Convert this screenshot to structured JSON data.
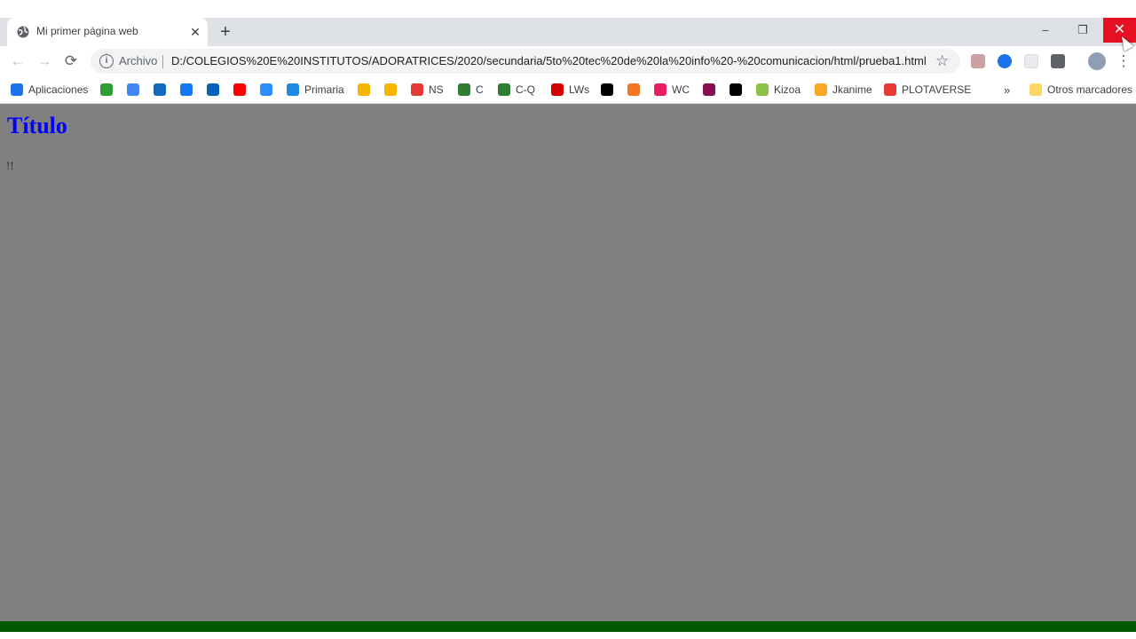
{
  "browser": {
    "tab": {
      "title": "Mi primer página web",
      "close_glyph": "✕"
    },
    "new_tab_glyph": "+",
    "window_controls": {
      "minimize": "–",
      "restore": "❐",
      "close": "✕"
    },
    "toolbar": {
      "back_glyph": "←",
      "forward_glyph": "→",
      "reload_glyph": "⟳",
      "security_label": "Archivo",
      "url": "D:/COLEGIOS%20E%20INSTITUTOS/ADORATRICES/2020/secundaria/5to%20tec%20de%20la%20info%20-%20comunicacion/html/prueba1.html",
      "star_glyph": "☆",
      "menu_glyph": "⋮"
    },
    "bookmarks": [
      {
        "label": "Aplicaciones",
        "icon": "apps-grid-icon",
        "color": "#1a73e8"
      },
      {
        "label": "",
        "icon": "green-circle-icon",
        "color": "#2e9e36"
      },
      {
        "label": "",
        "icon": "google-icon",
        "color": "#4285f4"
      },
      {
        "label": "",
        "icon": "outlook-icon",
        "color": "#0f6cbd"
      },
      {
        "label": "",
        "icon": "facebook-icon",
        "color": "#1877f2"
      },
      {
        "label": "",
        "icon": "onedrive-icon",
        "color": "#0364b8"
      },
      {
        "label": "",
        "icon": "youtube-icon",
        "color": "#ff0000"
      },
      {
        "label": "",
        "icon": "zoom-icon",
        "color": "#2d8cff"
      },
      {
        "label": "Primaria",
        "icon": "primaria-icon",
        "color": "#1e88e5"
      },
      {
        "label": "",
        "icon": "e-icon",
        "color": "#f5b400"
      },
      {
        "label": "",
        "icon": "classroom-icon",
        "color": "#f4b400"
      },
      {
        "label": "NS",
        "icon": "ns-icon",
        "color": "#e53935"
      },
      {
        "label": "C",
        "icon": "shield-c-icon",
        "color": "#2e7d32"
      },
      {
        "label": "C-Q",
        "icon": "shield-cq-icon",
        "color": "#2e7d32"
      },
      {
        "label": "LWs",
        "icon": "lws-icon",
        "color": "#d50000"
      },
      {
        "label": "",
        "icon": "star-black-icon",
        "color": "#000000"
      },
      {
        "label": "",
        "icon": "crunchyroll-icon",
        "color": "#f47521"
      },
      {
        "label": "WC",
        "icon": "wc-icon",
        "color": "#e91e63"
      },
      {
        "label": "",
        "icon": "pattern-icon",
        "color": "#880e4f"
      },
      {
        "label": "",
        "icon": "wix-icon",
        "color": "#000000"
      },
      {
        "label": "Kizoa",
        "icon": "kizoa-icon",
        "color": "#8bc34a"
      },
      {
        "label": "Jkanime",
        "icon": "jkanime-icon",
        "color": "#f9a825"
      },
      {
        "label": "PLOTAVERSE",
        "icon": "plotaverse-icon",
        "color": "#e53935"
      }
    ],
    "bookmarks_overflow": "»",
    "other_bookmarks": "Otros marcadores"
  },
  "page": {
    "heading": "Título",
    "paragraph": "!!",
    "background_color": "#808080",
    "heading_color": "#0000ff",
    "footer_color": "#005900"
  }
}
